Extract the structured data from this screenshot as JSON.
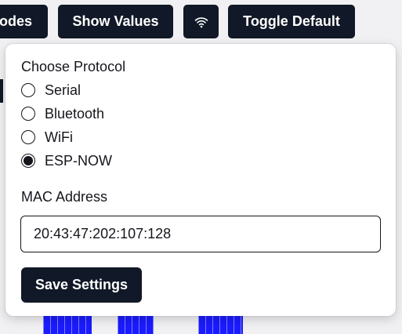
{
  "toolbar": {
    "modes_label": "odes",
    "show_values_label": "Show Values",
    "wifi_icon": "wifi-icon",
    "toggle_default_label": "Toggle Default"
  },
  "settings_popover": {
    "protocol_heading": "Choose Protocol",
    "protocols": [
      {
        "label": "Serial",
        "selected": false
      },
      {
        "label": "Bluetooth",
        "selected": false
      },
      {
        "label": "WiFi",
        "selected": false
      },
      {
        "label": "ESP-NOW",
        "selected": true
      }
    ],
    "mac_label": "MAC Address",
    "mac_value": "20:43:47:202:107:128",
    "save_label": "Save Settings"
  },
  "colors": {
    "button_bg": "#111827",
    "button_text": "#ffffff",
    "page_bg": "#f1f1f3",
    "popover_bg": "#ffffff",
    "text": "#15161c",
    "background_shapes": "#1b1bff"
  }
}
